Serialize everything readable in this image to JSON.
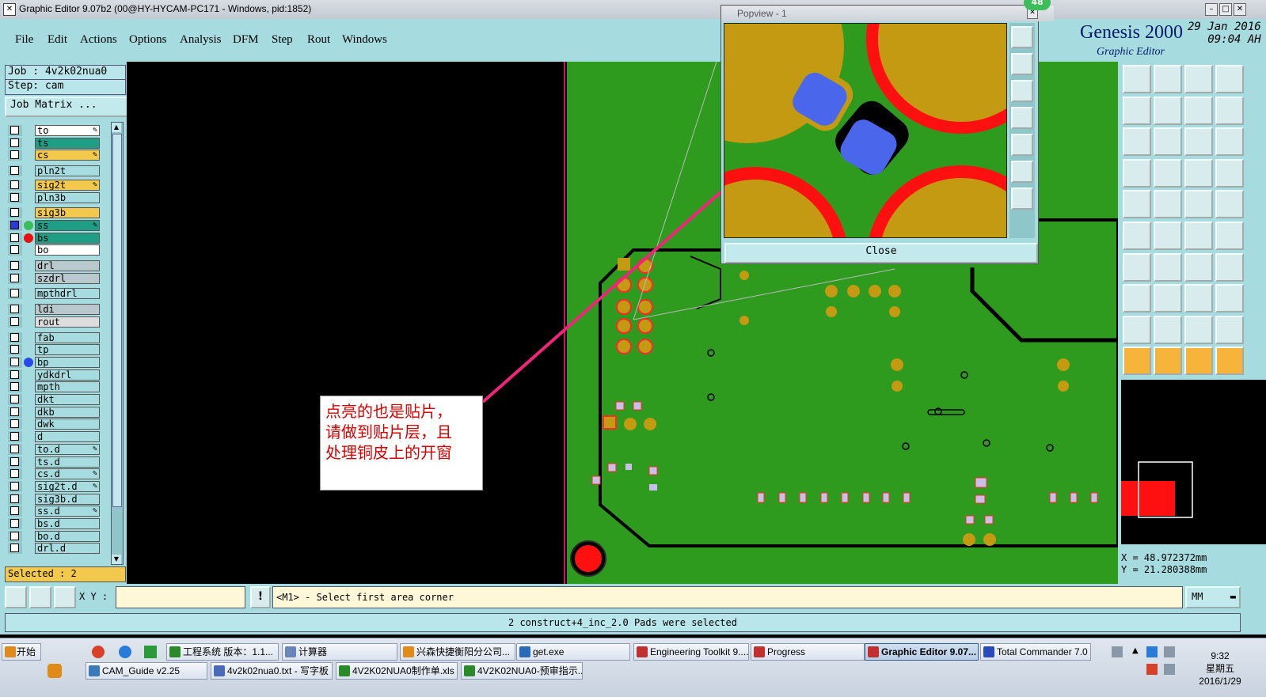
{
  "window": {
    "title": "Graphic Editor 9.07b2 (00@HY-HYCAM-PC171 - Windows, pid:1852)",
    "badge": "48"
  },
  "menu": [
    "File",
    "Edit",
    "Actions",
    "Options",
    "Analysis",
    "DFM",
    "Step",
    "Rout",
    "Windows"
  ],
  "brand": {
    "name": "Genesis 2000",
    "subtitle": "Graphic Editor",
    "date": "29 Jan 2016",
    "time": "09:04 AH"
  },
  "job": {
    "job": "Job : 4v2k02nua0",
    "step": "Step: cam",
    "matrix_button": "Job Matrix ..."
  },
  "layers": [
    {
      "name": "to",
      "color": "#ffffff",
      "mark": "pen"
    },
    {
      "name": "ts",
      "color": "#1f9e86",
      "mark": ""
    },
    {
      "name": "cs",
      "color": "#f2c94c",
      "mark": "pen"
    },
    {
      "name": "pln2t",
      "color": "#a6dcdf",
      "mark": ""
    },
    {
      "name": "sig2t",
      "color": "#f2c94c",
      "mark": "pen"
    },
    {
      "name": "pln3b",
      "color": "#a6dcdf",
      "mark": ""
    },
    {
      "name": "sig3b",
      "color": "#f2c94c",
      "mark": ""
    },
    {
      "name": "ss",
      "color": "#1f9e86",
      "mark": "pen"
    },
    {
      "name": "bs",
      "color": "#1f9e86",
      "mark": ""
    },
    {
      "name": "bo",
      "color": "#ffffff",
      "mark": ""
    },
    {
      "name": "drl",
      "color": "#b8c8cc",
      "mark": ""
    },
    {
      "name": "szdrl",
      "color": "#b8c8cc",
      "mark": ""
    },
    {
      "name": "mpthdrl",
      "color": "#a6dcdf",
      "mark": ""
    },
    {
      "name": "ldi",
      "color": "#b8c8cc",
      "mark": ""
    },
    {
      "name": "rout",
      "color": "#dddddd",
      "mark": ""
    },
    {
      "name": "fab",
      "color": "#a6dcdf",
      "mark": ""
    },
    {
      "name": "tp",
      "color": "#a6dcdf",
      "mark": ""
    },
    {
      "name": "bp",
      "color": "#a6dcdf",
      "mark": ""
    },
    {
      "name": "ydkdrl",
      "color": "#a6dcdf",
      "mark": ""
    },
    {
      "name": "mpth",
      "color": "#a6dcdf",
      "mark": ""
    },
    {
      "name": "dkt",
      "color": "#a6dcdf",
      "mark": ""
    },
    {
      "name": "dkb",
      "color": "#a6dcdf",
      "mark": ""
    },
    {
      "name": "dwk",
      "color": "#a6dcdf",
      "mark": ""
    },
    {
      "name": "d",
      "color": "#a6dcdf",
      "mark": ""
    },
    {
      "name": "to.d",
      "color": "#a6dcdf",
      "mark": "pen"
    },
    {
      "name": "ts.d",
      "color": "#a6dcdf",
      "mark": ""
    },
    {
      "name": "cs.d",
      "color": "#a6dcdf",
      "mark": "pen"
    },
    {
      "name": "sig2t.d",
      "color": "#a6dcdf",
      "mark": "pen"
    },
    {
      "name": "sig3b.d",
      "color": "#a6dcdf",
      "mark": ""
    },
    {
      "name": "ss.d",
      "color": "#a6dcdf",
      "mark": "pen"
    },
    {
      "name": "bs.d",
      "color": "#a6dcdf",
      "mark": ""
    },
    {
      "name": "bo.d",
      "color": "#a6dcdf",
      "mark": ""
    },
    {
      "name": "drl.d",
      "color": "#a6dcdf",
      "mark": ""
    }
  ],
  "selected": "Selected : 2",
  "annotation": [
    "点亮的也是贴片，",
    "请做到贴片层，且",
    "处理铜皮上的开窗"
  ],
  "popview": {
    "title": "Popview - 1",
    "close_label": "Close"
  },
  "coordinates": {
    "x": "X = 48.972372mm",
    "y": "Y = 21.280388mm"
  },
  "status": {
    "xy_label": "X Y :",
    "xy_value": "",
    "prompt": "<M1> - Select first area corner",
    "units": "MM"
  },
  "message": "2 construct+4_inc_2.0 Pads were selected",
  "taskbar": {
    "start": "开始",
    "row1": [
      {
        "label": "工程系统  版本：1.1...",
        "icon_color": "#2a8a2a",
        "active": false
      },
      {
        "label": "计算器",
        "icon_color": "#6a86b8",
        "active": false
      },
      {
        "label": "兴森快捷衡阳分公司...",
        "icon_color": "#e08a1a",
        "active": false
      },
      {
        "label": "get.exe",
        "icon_color": "#2a6ab8",
        "active": false
      },
      {
        "label": "Engineering Toolkit 9....",
        "icon_color": "#c03030",
        "active": false
      },
      {
        "label": "Progress",
        "icon_color": "#c03030",
        "active": false
      },
      {
        "label": "Graphic Editor 9.07...",
        "icon_color": "#c03030",
        "active": true
      },
      {
        "label": "Total Commander 7.0 ...",
        "icon_color": "#2a4ab8",
        "active": false
      }
    ],
    "row2": [
      {
        "label": "CAM_Guide v2.25",
        "icon_color": "#3a7ab8",
        "active": false
      },
      {
        "label": "4v2k02nua0.txt - 写字板",
        "icon_color": "#4a6ab8",
        "active": false
      },
      {
        "label": "4V2K02NUA0制作单.xls ...",
        "icon_color": "#2a8a2a",
        "active": false
      },
      {
        "label": "4V2K02NUA0-预审指示....",
        "icon_color": "#2a8a2a",
        "active": false
      }
    ],
    "clock": "9:32",
    "weekday": "星期五",
    "date": "2016/1/29"
  }
}
